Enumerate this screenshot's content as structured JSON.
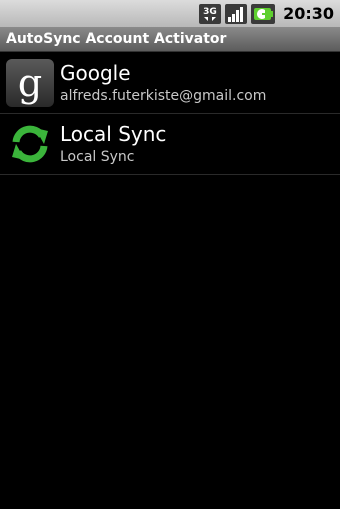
{
  "status_bar": {
    "network_icon": "3g-icon",
    "signal_icon": "signal-strength-icon",
    "battery_icon": "battery-charging-icon",
    "time": "20:30"
  },
  "app": {
    "title": "AutoSync Account Activator"
  },
  "accounts": [
    {
      "icon": "google-icon",
      "icon_glyph": "g",
      "name": "Google",
      "detail": "alfreds.futerkiste@gmail.com"
    },
    {
      "icon": "sync-icon",
      "name": "Local Sync",
      "detail": "Local Sync"
    }
  ],
  "colors": {
    "sync_green": "#3bb43b",
    "background": "#000000"
  }
}
